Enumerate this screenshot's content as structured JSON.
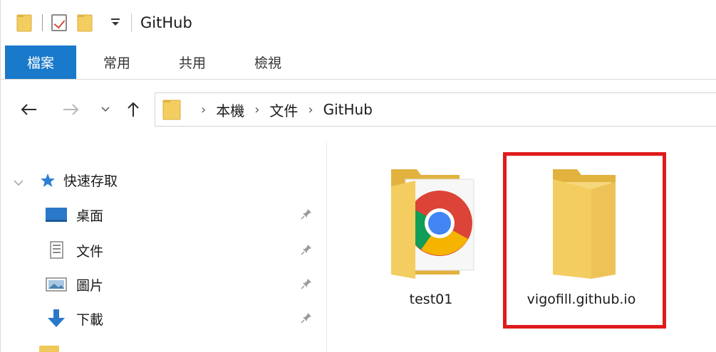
{
  "window": {
    "title": "GitHub"
  },
  "quick_access_toolbar": {
    "icons": [
      "folder-icon",
      "properties-check-icon",
      "new-folder-icon",
      "customize-dropdown-icon"
    ],
    "dropdown_glyph": "▾"
  },
  "ribbon": {
    "tabs": [
      {
        "label": "檔案",
        "active": true
      },
      {
        "label": "常用",
        "active": false
      },
      {
        "label": "共用",
        "active": false
      },
      {
        "label": "檢視",
        "active": false
      }
    ],
    "active_color": "#1979ca"
  },
  "navigation": {
    "back_glyph": "←",
    "forward_glyph": "→",
    "recent_glyph": "⌄",
    "up_glyph": "↑"
  },
  "address_bar": {
    "separator": "›",
    "breadcrumbs": [
      "本機",
      "文件",
      "GitHub"
    ]
  },
  "sidebar": {
    "quick_access_label": "快速存取",
    "items": [
      {
        "label": "桌面",
        "icon": "desktop-icon",
        "pinned": true
      },
      {
        "label": "文件",
        "icon": "documents-icon",
        "pinned": true
      },
      {
        "label": "圖片",
        "icon": "pictures-icon",
        "pinned": true
      },
      {
        "label": "下載",
        "icon": "download-icon",
        "pinned": true
      }
    ]
  },
  "content": {
    "files": [
      {
        "name": "test01",
        "icon": "folder-chrome-icon"
      },
      {
        "name": "vigofill.github.io",
        "icon": "folder-icon",
        "highlighted": true
      }
    ],
    "highlight_color": "#e01b1b"
  },
  "colors": {
    "folder": "#f3cd5f",
    "folder_dark": "#e2b23e",
    "accent": "#1979ca"
  }
}
